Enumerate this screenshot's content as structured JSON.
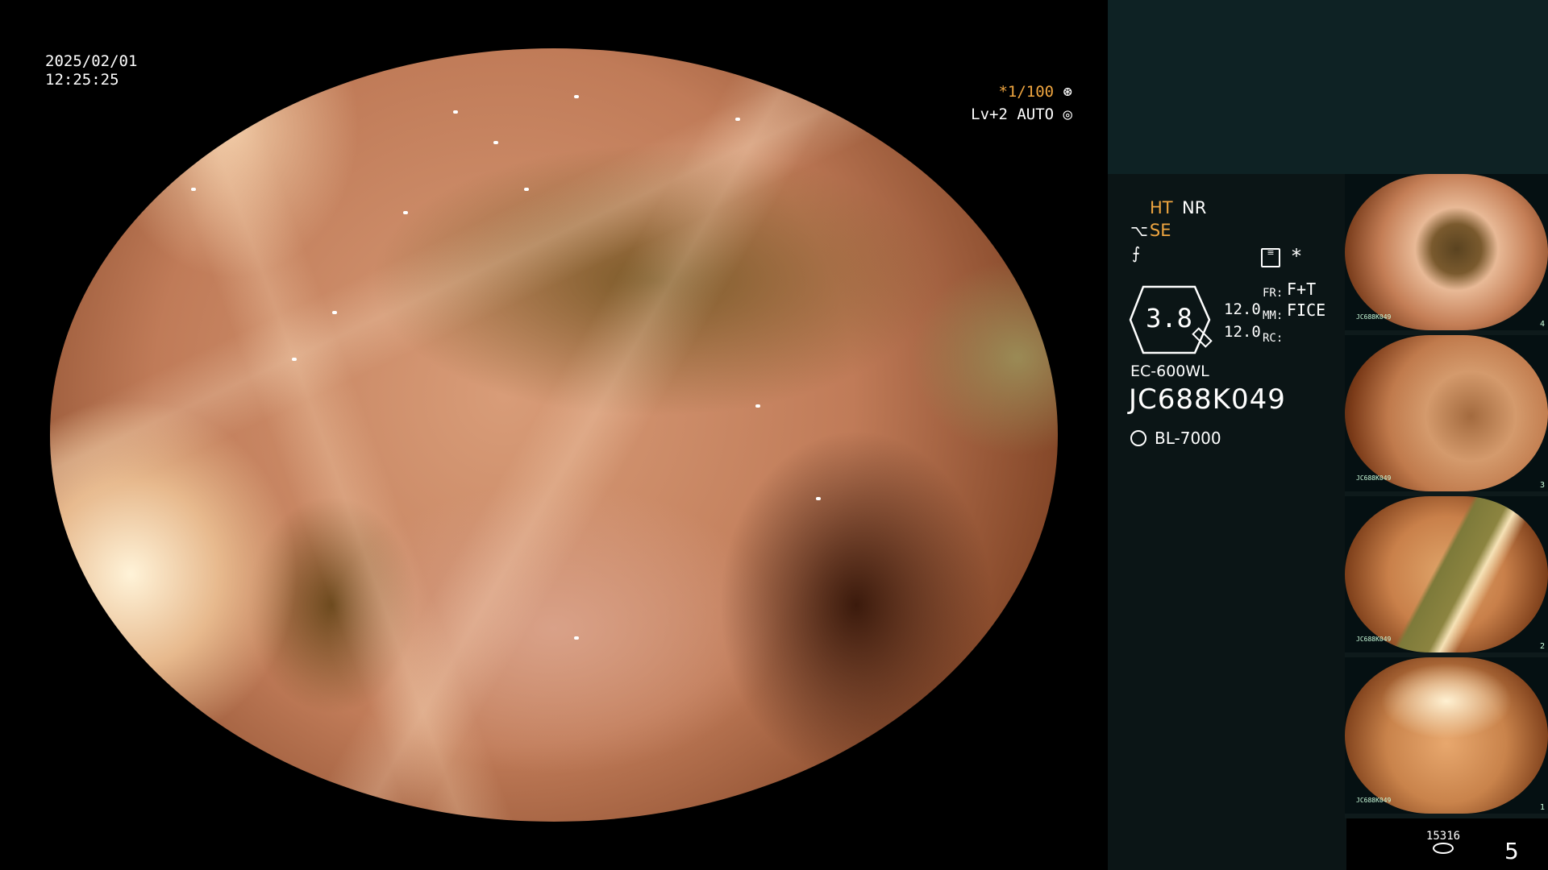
{
  "overlay": {
    "date": "2025/02/01",
    "time": "12:25:25",
    "shutter": "*1/100",
    "level": "Lv+2 AUTO"
  },
  "panel": {
    "ht": "HT",
    "nr": "NR",
    "se": "SE",
    "gauge_value": "3.8",
    "mm_values": [
      "12.0",
      "12.0"
    ],
    "mode_labels": [
      "FR:",
      "MM:",
      "RC:"
    ],
    "mode_values": [
      "F+T",
      "FICE"
    ],
    "scope_model": "EC-600WL",
    "serial": "JC688K049",
    "light_source": "BL-7000"
  },
  "thumbnails": [
    {
      "label": "JC688K049",
      "index": "4"
    },
    {
      "label": "JC688K049",
      "index": "3"
    },
    {
      "label": "JC688K049",
      "index": "2"
    },
    {
      "label": "JC688K049",
      "index": "1"
    }
  ],
  "footer": {
    "image_count": "15316",
    "page_number": "5"
  },
  "colors": {
    "accent": "#f0a640",
    "panel_top": "#0e2224",
    "panel_info": "#0b1516"
  }
}
